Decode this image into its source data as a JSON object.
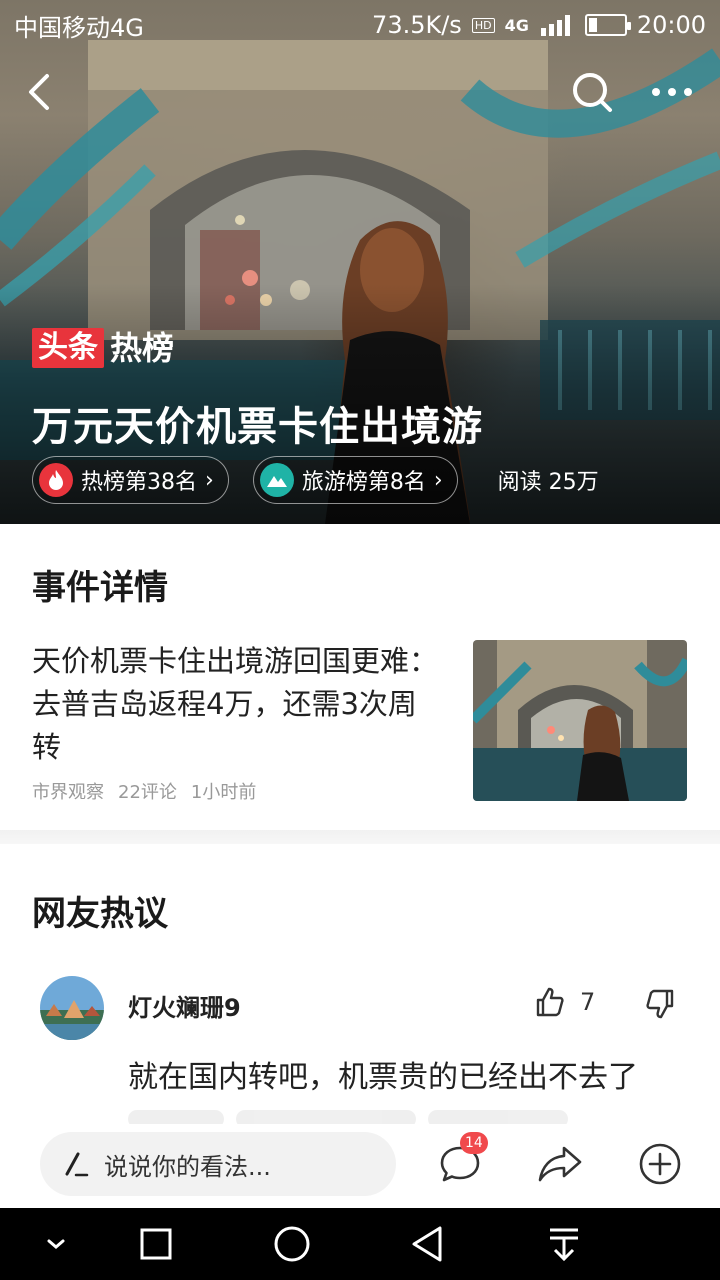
{
  "status_bar": {
    "carrier": "中国移动4G",
    "net_speed": "73.5K/s",
    "hd_tag": "HD",
    "signal_label": "4G",
    "time": "20:00"
  },
  "hero": {
    "logo_red": "头条",
    "logo_white": "热榜",
    "title": "万元天价机票卡住出境游",
    "chips": [
      {
        "label": "热榜第38名",
        "icon": "flame-icon"
      },
      {
        "label": "旅游榜第8名",
        "icon": "mountain-icon"
      }
    ],
    "read_count": "阅读 25万"
  },
  "event": {
    "section_title": "事件详情",
    "headline": "天价机票卡住出境游回国更难：去普吉岛返程4万，还需3次周转",
    "source": "市界观察",
    "comments": "22评论",
    "time": "1小时前"
  },
  "comments_section": {
    "title": "网友热议",
    "items": [
      {
        "user": "灯火斓珊9",
        "likes": "7",
        "text": "就在国内转吧，机票贵的已经出不去了"
      }
    ]
  },
  "action_bar": {
    "input_placeholder": "说说你的看法...",
    "comment_count": "14"
  },
  "colors": {
    "accent_red": "#e8343c",
    "teal": "#1fb3a6",
    "badge_red": "#f0494c"
  }
}
